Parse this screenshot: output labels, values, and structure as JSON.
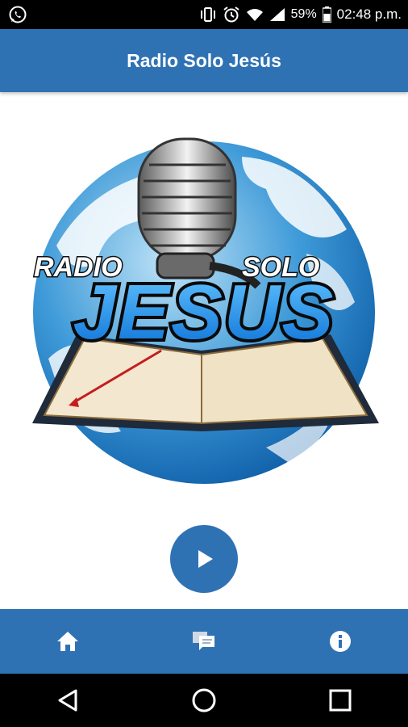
{
  "status_bar": {
    "notification_icon": "whatsapp-icon",
    "battery_percent": "59%",
    "time": "02:48 p.m."
  },
  "app_bar": {
    "title": "Radio Solo Jesús",
    "color": "#2f72b4"
  },
  "logo": {
    "top_text_left": "RADIO",
    "top_text_right": "SOLO",
    "main_text": "JESUS"
  },
  "player": {
    "play_icon": "play-icon",
    "color": "#2f72b4"
  },
  "bottom_nav": {
    "items": [
      {
        "icon": "home-icon"
      },
      {
        "icon": "chat-icon"
      },
      {
        "icon": "info-icon"
      }
    ]
  },
  "system_nav": {
    "items": [
      {
        "icon": "back-icon"
      },
      {
        "icon": "home-circle-icon"
      },
      {
        "icon": "recents-icon"
      }
    ]
  }
}
